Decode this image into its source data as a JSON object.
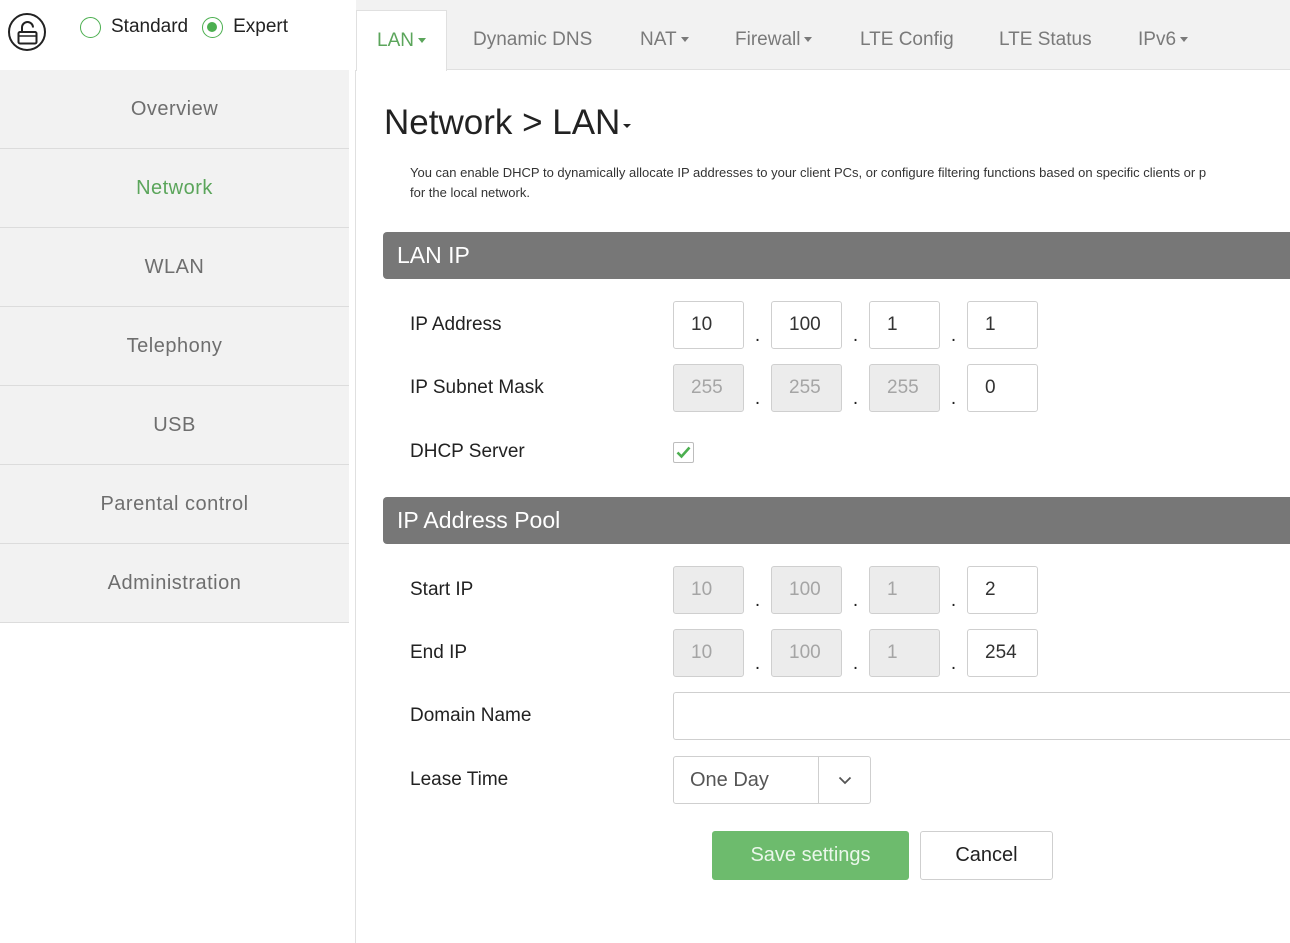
{
  "mode": {
    "standard_label": "Standard",
    "expert_label": "Expert",
    "selected": "Expert"
  },
  "sidebar": {
    "items": [
      {
        "label": "Overview"
      },
      {
        "label": "Network"
      },
      {
        "label": "WLAN"
      },
      {
        "label": "Telephony"
      },
      {
        "label": "USB"
      },
      {
        "label": "Parental control"
      },
      {
        "label": "Administration"
      }
    ],
    "active": "Network"
  },
  "tabs": [
    {
      "label": "LAN",
      "dropdown": true
    },
    {
      "label": "Dynamic DNS",
      "dropdown": false
    },
    {
      "label": "NAT",
      "dropdown": true
    },
    {
      "label": "Firewall",
      "dropdown": true
    },
    {
      "label": "LTE Config",
      "dropdown": false
    },
    {
      "label": "LTE Status",
      "dropdown": false
    },
    {
      "label": "IPv6",
      "dropdown": true
    }
  ],
  "page": {
    "title": "Network > LAN",
    "description_line1": "You can enable DHCP to dynamically allocate IP addresses to your client PCs, or configure filtering functions based on specific clients or p",
    "description_line2": "for the local network."
  },
  "lan_ip": {
    "section_title": "LAN IP",
    "ip_address_label": "IP Address",
    "ip_address": [
      "10",
      "100",
      "1",
      "1"
    ],
    "subnet_label": "IP Subnet Mask",
    "subnet": [
      "255",
      "255",
      "255",
      "0"
    ],
    "dhcp_label": "DHCP Server",
    "dhcp_enabled": true
  },
  "pool": {
    "section_title": "IP Address Pool",
    "start_label": "Start IP",
    "start_ip": [
      "10",
      "100",
      "1",
      "2"
    ],
    "end_label": "End IP",
    "end_ip": [
      "10",
      "100",
      "1",
      "254"
    ],
    "domain_label": "Domain Name",
    "domain_value": "",
    "lease_label": "Lease Time",
    "lease_value": "One Day"
  },
  "actions": {
    "save_label": "Save settings",
    "cancel_label": "Cancel"
  },
  "colors": {
    "accent": "#5ba55b",
    "section_bar": "#777777",
    "save_button": "#6dbb6d"
  }
}
